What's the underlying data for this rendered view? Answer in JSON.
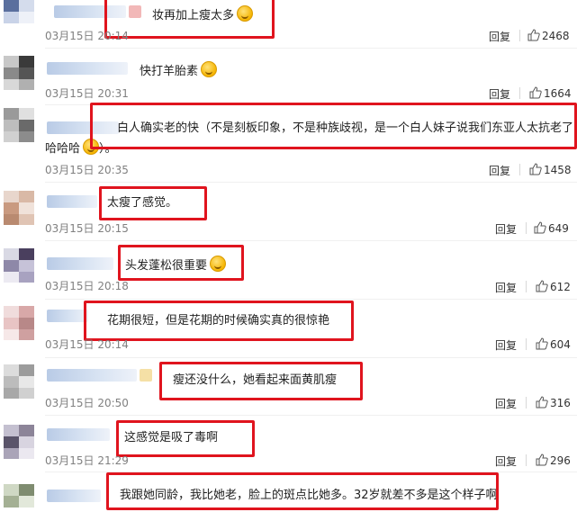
{
  "reply_label": "回复",
  "comments": [
    {
      "text": "妆再加上瘦太多",
      "emoji": "crying-face-icon",
      "time": "03月15日 20:14",
      "likes": "2468"
    },
    {
      "text": "快打羊胎素",
      "emoji": "crying-face-icon",
      "time": "03月15日 20:31",
      "likes": "1664"
    },
    {
      "text": "白人确实老的快（不是刻板印象，不是种族歧视，是一个白人妹子说我们东亚人太抗老了，哈",
      "text2": "哈哈哈",
      "emoji": "laughing-face-icon",
      "text2_after": "）。",
      "time": "03月15日 20:35",
      "likes": "1458"
    },
    {
      "text": "太瘦了感觉。",
      "time": "03月15日 20:15",
      "likes": "649"
    },
    {
      "text": "头发蓬松很重要",
      "emoji": "laughing-face-icon",
      "time": "03月15日 20:18",
      "likes": "612"
    },
    {
      "text": "花期很短，但是花期的时候确实真的很惊艳",
      "time": "03月15日 20:14",
      "likes": "604"
    },
    {
      "text": "瘦还没什么，她看起来面黄肌瘦",
      "time": "03月15日 20:50",
      "likes": "316"
    },
    {
      "text": "这感觉是吸了毒啊",
      "time": "03月15日 21:29",
      "likes": "296"
    },
    {
      "text": "我跟她同龄，我比她老，脸上的斑点比她多。32岁就差不多是这个样子啊"
    }
  ],
  "colors": {
    "highlight_box": "#e0141e",
    "timestamp": "#808080",
    "text": "#222222"
  }
}
